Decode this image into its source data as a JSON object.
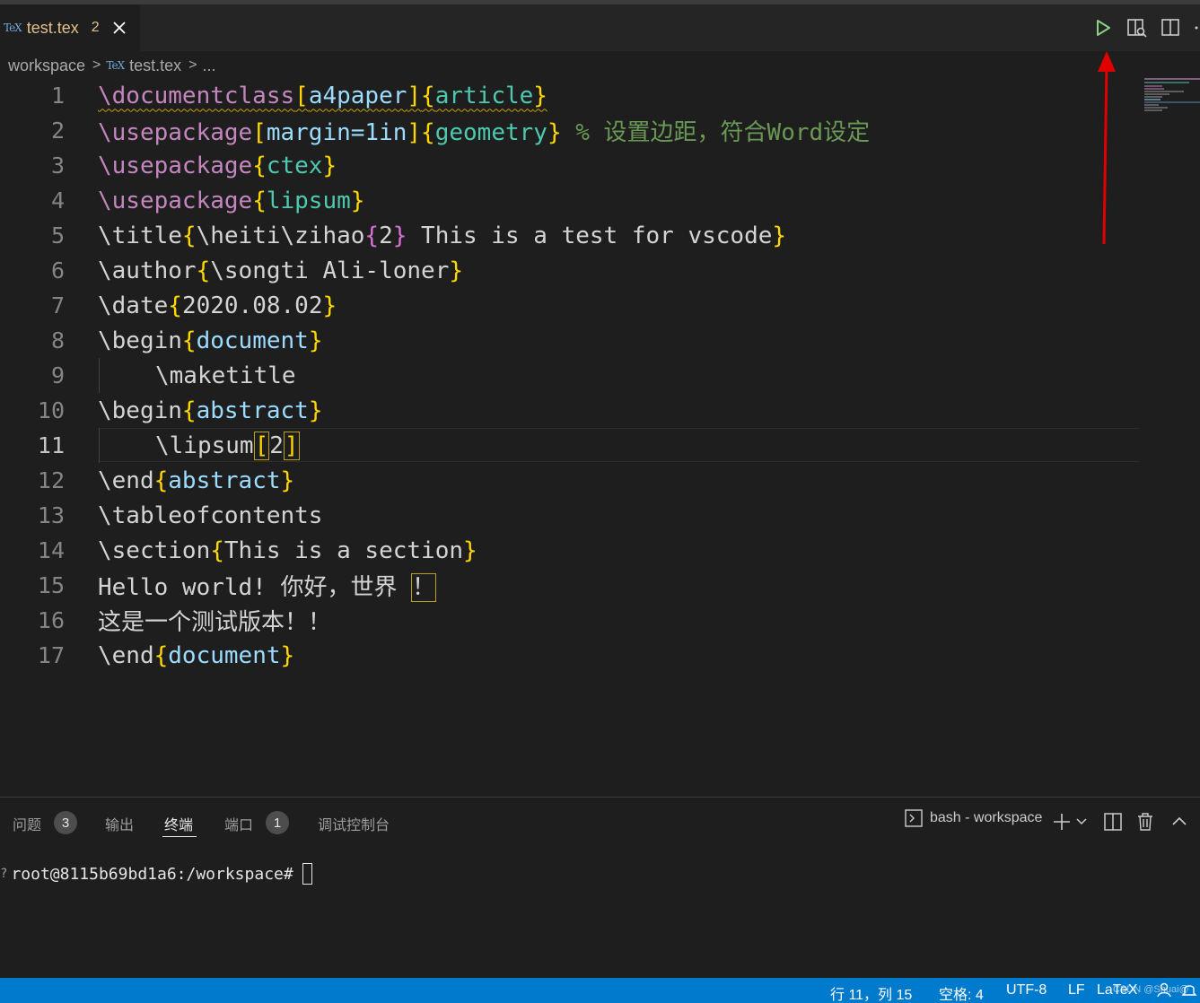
{
  "tab": {
    "badge": "TeX",
    "filename": "test.tex",
    "problem_count": "2"
  },
  "breadcrumb": {
    "root": "workspace",
    "badge": "TeX",
    "file": "test.tex",
    "more": "..."
  },
  "editor": {
    "active_line": 11,
    "lines": [
      {
        "n": "1"
      },
      {
        "n": "2"
      },
      {
        "n": "3"
      },
      {
        "n": "4"
      },
      {
        "n": "5"
      },
      {
        "n": "6"
      },
      {
        "n": "7"
      },
      {
        "n": "8"
      },
      {
        "n": "9"
      },
      {
        "n": "10"
      },
      {
        "n": "11"
      },
      {
        "n": "12"
      },
      {
        "n": "13"
      },
      {
        "n": "14"
      },
      {
        "n": "15"
      },
      {
        "n": "16"
      },
      {
        "n": "17"
      }
    ],
    "code": {
      "l1": {
        "cmd": "\\documentclass",
        "opt": "a4paper",
        "arg": "article"
      },
      "l2": {
        "cmd": "\\usepackage",
        "opt": "margin=1in",
        "arg": "geometry",
        "comment": "% 设置边距，符合Word设定"
      },
      "l3": {
        "cmd": "\\usepackage",
        "arg": "ctex"
      },
      "l4": {
        "cmd": "\\usepackage",
        "arg": "lipsum"
      },
      "l5": {
        "cmd": "\\title",
        "inner1": "\\heiti\\zihao",
        "inner2": "2",
        "text": " This is a test for vscode"
      },
      "l6": {
        "cmd": "\\author",
        "text": "\\songti Ali-loner"
      },
      "l7": {
        "cmd": "\\date",
        "text": "2020.08.02"
      },
      "l8": {
        "cmd": "\\begin",
        "arg": "document"
      },
      "l9": {
        "text": "\\maketitle"
      },
      "l10": {
        "cmd": "\\begin",
        "arg": "abstract"
      },
      "l11": {
        "cmd": "\\lipsum",
        "opt": "2"
      },
      "l12": {
        "cmd": "\\end",
        "arg": "abstract"
      },
      "l13": {
        "text": "\\tableofcontents"
      },
      "l14": {
        "cmd": "\\section",
        "text": "This is a section"
      },
      "l15": {
        "text": "Hello world! 你好，世界 ",
        "boxed": "！"
      },
      "l16": {
        "text": "这是一个测试版本！！"
      },
      "l17": {
        "cmd": "\\end",
        "arg": "document"
      }
    }
  },
  "panel": {
    "tabs": [
      {
        "label": "问题",
        "badge": "3"
      },
      {
        "label": "输出"
      },
      {
        "label": "终端"
      },
      {
        "label": "端口",
        "badge": "1"
      },
      {
        "label": "调试控制台"
      }
    ],
    "active_tab": "终端",
    "terminal_name": "bash - workspace",
    "prompt": "root@8115b69bd1a6:/workspace#"
  },
  "status": {
    "position": "行 11，列 15",
    "spaces": "空格: 4",
    "encoding": "UTF-8",
    "eol": "LF",
    "language": "LaTeX",
    "watermark": "CSDN @Shuai@"
  },
  "colors": {
    "statusbar": "#007acc",
    "annotation_arrow": "#e00000",
    "run_icon": "#89d185"
  }
}
